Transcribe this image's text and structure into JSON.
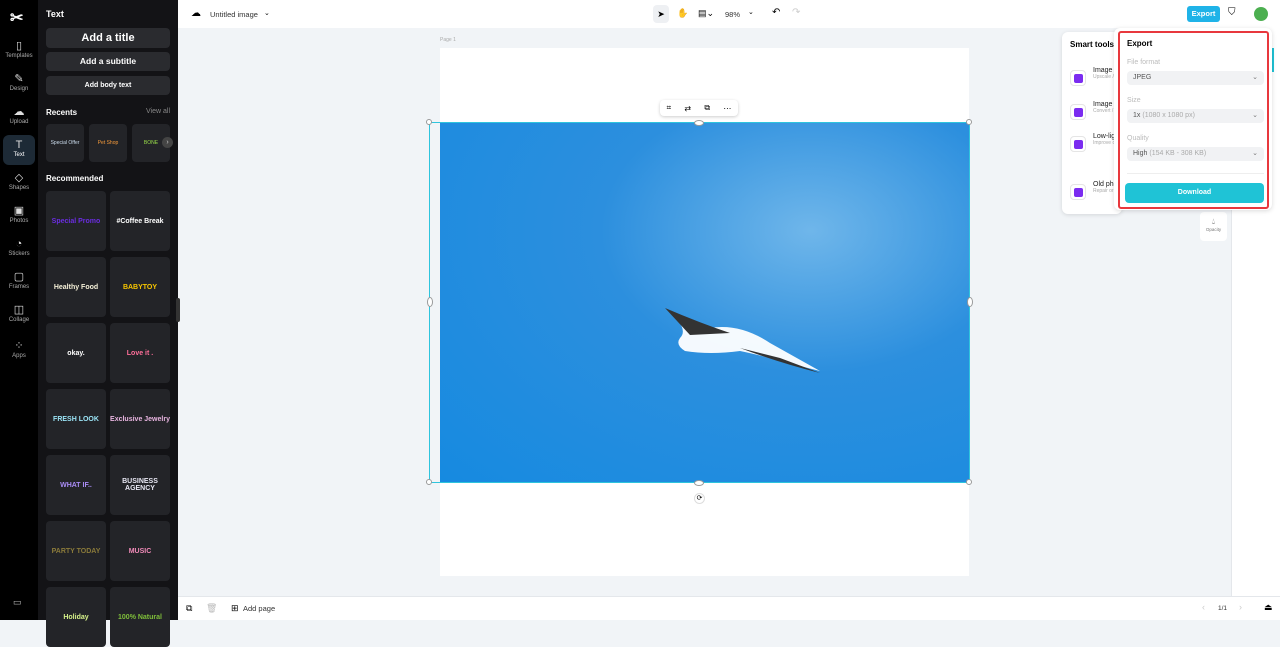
{
  "rail": {
    "items": [
      {
        "label": "Templates",
        "icon": "▯"
      },
      {
        "label": "Design",
        "icon": "✎"
      },
      {
        "label": "Upload",
        "icon": "☁"
      },
      {
        "label": "Text",
        "icon": "T"
      },
      {
        "label": "Shapes",
        "icon": "◇"
      },
      {
        "label": "Photos",
        "icon": "▣"
      },
      {
        "label": "Stickers",
        "icon": "◔"
      },
      {
        "label": "Frames",
        "icon": "▢"
      },
      {
        "label": "Collage",
        "icon": "◫"
      },
      {
        "label": "Apps",
        "icon": "⁘"
      }
    ],
    "active": "Text"
  },
  "panel": {
    "title": "Text",
    "add_title": "Add a title",
    "add_subtitle": "Add a subtitle",
    "add_body": "Add body text",
    "recents": "Recents",
    "view_all": "View all",
    "recent_items": [
      "Special Offer",
      "Pet Shop",
      "BONE"
    ],
    "recommended": "Recommended",
    "cards": [
      {
        "text": "Special Promo",
        "color": "#6a2de0"
      },
      {
        "text": "#Coffee Break",
        "color": "#ffffff"
      },
      {
        "text": "Healthy Food",
        "color": "#f5f0d8"
      },
      {
        "text": "BABYTOY",
        "color": "#f7c600"
      },
      {
        "text": "okay.",
        "color": "#ffffff"
      },
      {
        "text": "Love it .",
        "color": "#ff6f9a"
      },
      {
        "text": "FRESH LOOK",
        "color": "#9ae3f5"
      },
      {
        "text": "Exclusive Jewelry",
        "color": "#e8b4e0"
      },
      {
        "text": "WHAT IF..",
        "color": "#a98cf5"
      },
      {
        "text": "BUSINESS AGENCY",
        "color": "#e8e8f4"
      },
      {
        "text": "PARTY TODAY",
        "color": "#8a7a3a"
      },
      {
        "text": "MUSIC",
        "color": "#f08ab8"
      },
      {
        "text": "Holiday",
        "color": "#d6f28a"
      },
      {
        "text": "100% Natural",
        "color": "#7fbf3a"
      }
    ]
  },
  "topbar": {
    "doc_title": "Untitled image",
    "zoom": "98%",
    "export": "Export"
  },
  "canvas": {
    "page_label": "Page 1"
  },
  "smart_tools": {
    "title": "Smart tools",
    "items": [
      {
        "title": "Image",
        "desc": "Upscale / increase"
      },
      {
        "title": "Image",
        "desc": "Convert / various"
      },
      {
        "title": "Low-light enhance",
        "desc": "Improve quality"
      },
      {
        "title": "Old photo",
        "desc": "Repair or bring"
      }
    ]
  },
  "export_panel": {
    "title": "Export",
    "file_format_label": "File format",
    "file_format": "JPEG",
    "size_label": "Size",
    "size": "1x",
    "size_detail": "(1080 x 1080 px)",
    "quality_label": "Quality",
    "quality": "High",
    "quality_detail": "(154 KB - 308 KB)",
    "download": "Download"
  },
  "opacity": "Opacity",
  "bottom": {
    "add_page": "Add page",
    "page_count": "1/1"
  },
  "colors": {
    "accent": "#1fc3d6",
    "highlight": "#e8383d"
  }
}
